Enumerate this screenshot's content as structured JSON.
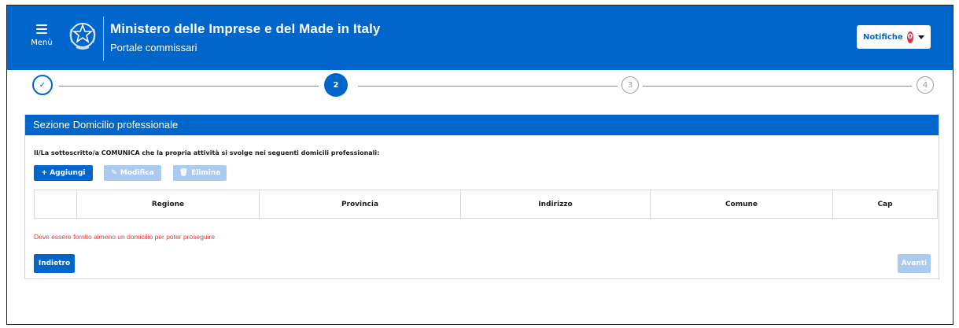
{
  "header": {
    "menu_label": "Menù",
    "title": "Ministero delle Imprese e del Made in Italy",
    "subtitle": "Portale commissari",
    "notifications_label": "Notifiche",
    "notifications_count": "0",
    "emblem_icon": "italian-republic-emblem-icon",
    "brand_color": "#0066cc"
  },
  "stepper": {
    "steps": [
      {
        "label": "✓",
        "status": "completed"
      },
      {
        "label": "2",
        "status": "active"
      },
      {
        "label": "3",
        "status": "todo"
      },
      {
        "label": "4",
        "status": "todo"
      }
    ]
  },
  "section": {
    "title": "Sezione Domicilio professionale",
    "declaration": "Il/La sottoscritto/a COMUNICA che la propria attività si svolge nei seguenti domicili professionali:",
    "actions": {
      "add_label": "+ Aggiungi",
      "edit_label": "Modifica",
      "delete_label": "Elimina"
    },
    "table": {
      "columns": [
        "",
        "Regione",
        "Provincia",
        "Indirizzo",
        "Comune",
        "Cap"
      ]
    },
    "error": "Deve essere fornito almeno un domicilio per poter proseguire",
    "back_label": "Indietro",
    "next_label": "Avanti"
  }
}
